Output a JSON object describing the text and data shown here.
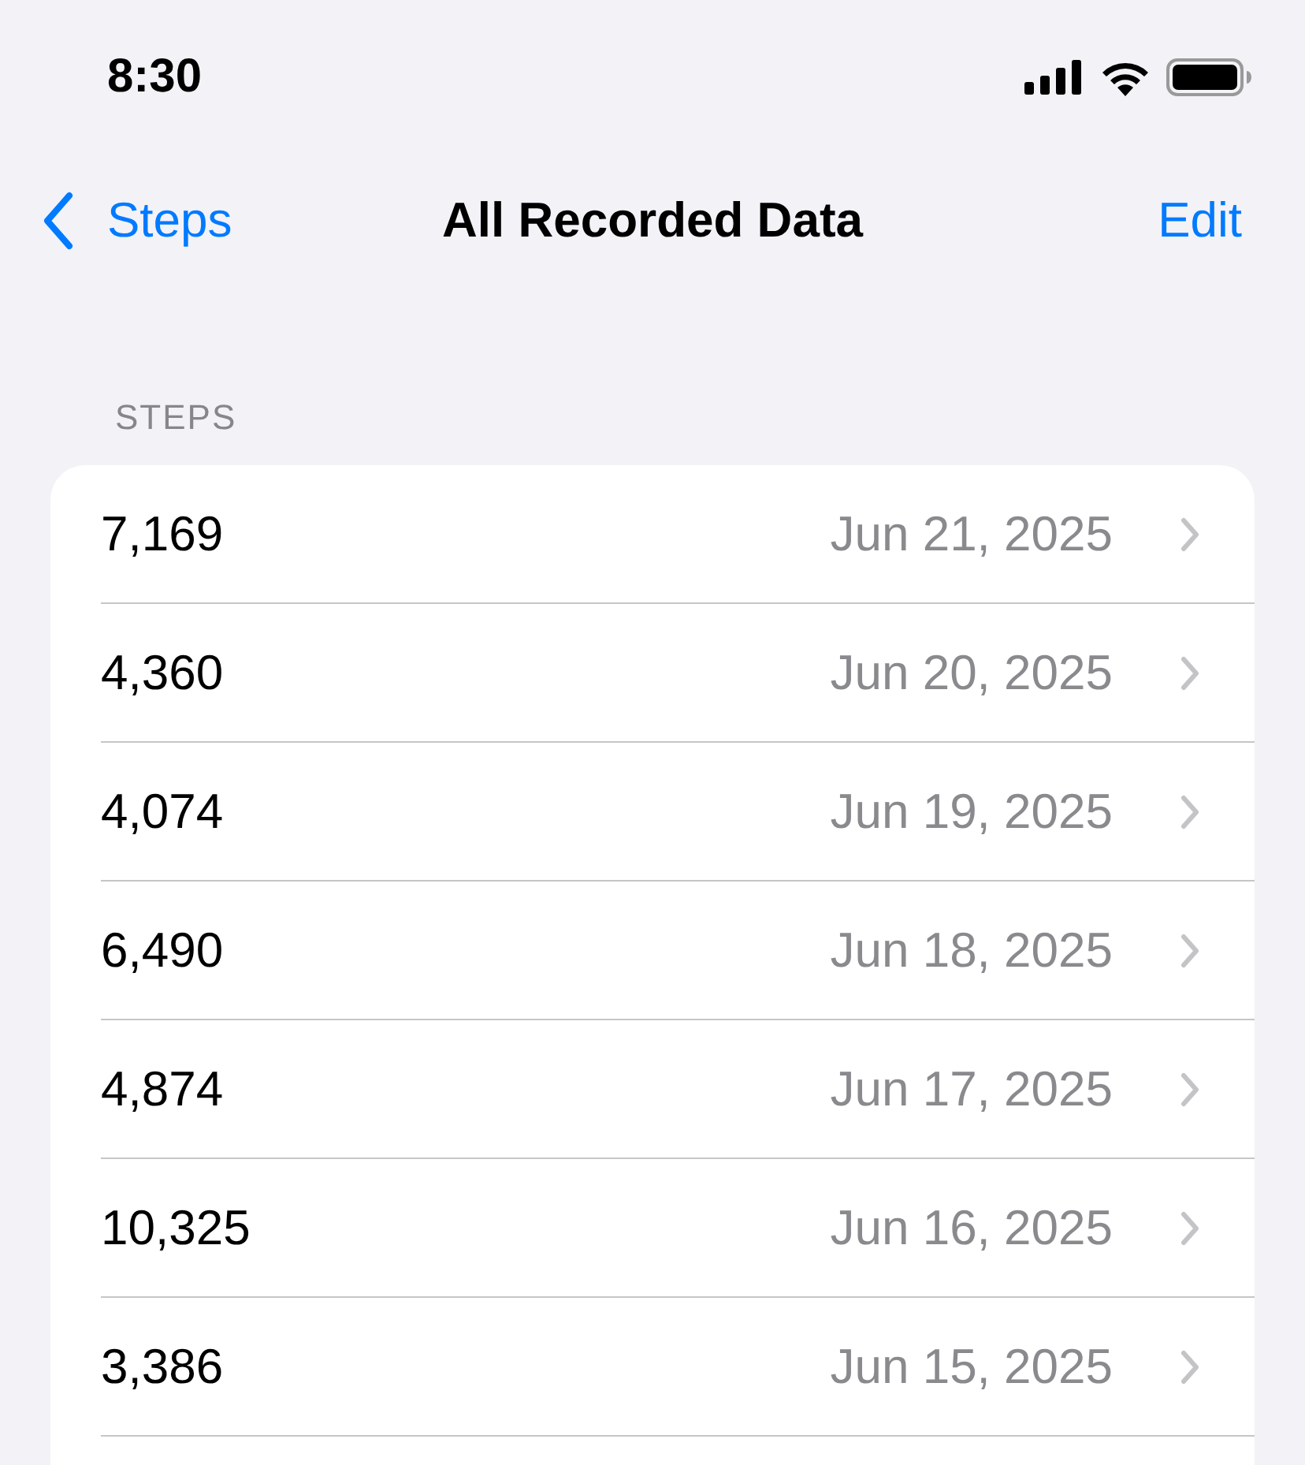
{
  "status_bar": {
    "time": "8:30"
  },
  "nav": {
    "back": "Steps",
    "title": "All Recorded Data",
    "action": "Edit"
  },
  "section": {
    "header": "STEPS",
    "rows": [
      {
        "value": "7,169",
        "date": "Jun 21, 2025"
      },
      {
        "value": "4,360",
        "date": "Jun 20, 2025"
      },
      {
        "value": "4,074",
        "date": "Jun 19, 2025"
      },
      {
        "value": "6,490",
        "date": "Jun 18, 2025"
      },
      {
        "value": "4,874",
        "date": "Jun 17, 2025"
      },
      {
        "value": "10,325",
        "date": "Jun 16, 2025"
      },
      {
        "value": "3,386",
        "date": "Jun 15, 2025"
      }
    ]
  }
}
